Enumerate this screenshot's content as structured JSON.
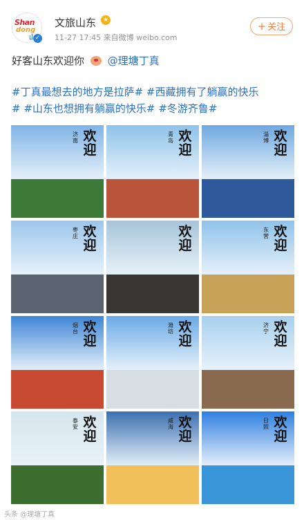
{
  "post": {
    "author": "文旅山东",
    "time": "11-27 17:45",
    "source": "来自微博 weibo.com",
    "follow_label": "关注",
    "greeting": "好客山东欢迎你",
    "mention": "@理塘丁真",
    "topics_line1": "#丁真最想去的地方是拉萨# #西藏拥有了躺赢的快乐",
    "topics_line2": "# #山东也想拥有躺赢的快乐# #冬游齐鲁#"
  },
  "grid": {
    "welcome": "欢迎你",
    "tiles": [
      {
        "city": "济南",
        "sky": "#7fb4e6",
        "ground": "#3d7a3a"
      },
      {
        "city": "青岛",
        "sky": "#8ec3ea",
        "ground": "#b9553a"
      },
      {
        "city": "淄博",
        "sky": "#6ea8e0",
        "ground": "#2e5a9c"
      },
      {
        "city": "枣庄",
        "sky": "#9cc6ec",
        "ground": "#5a6470"
      },
      {
        "city": "",
        "sky": "#a7c4d8",
        "ground": "#3a3633"
      },
      {
        "city": "东营",
        "sky": "#8fc2ea",
        "ground": "#c9a25a"
      },
      {
        "city": "烟台",
        "sky": "#3f86d6",
        "ground": "#c84a32"
      },
      {
        "city": "潍坊",
        "sky": "#6aaae6",
        "ground": "#d6dde3"
      },
      {
        "city": "济宁",
        "sky": "#a8d0ee",
        "ground": "#8a6a4e"
      },
      {
        "city": "泰安",
        "sky": "#d7e6ee",
        "ground": "#3d6d2f"
      },
      {
        "city": "威海",
        "sky": "#3c6fb0",
        "ground": "#f1c05a"
      },
      {
        "city": "日照",
        "sky": "#2f7fe0",
        "ground": "#3a95d8"
      }
    ]
  },
  "footer": {
    "watermark": "头条 @理塘丁真"
  }
}
